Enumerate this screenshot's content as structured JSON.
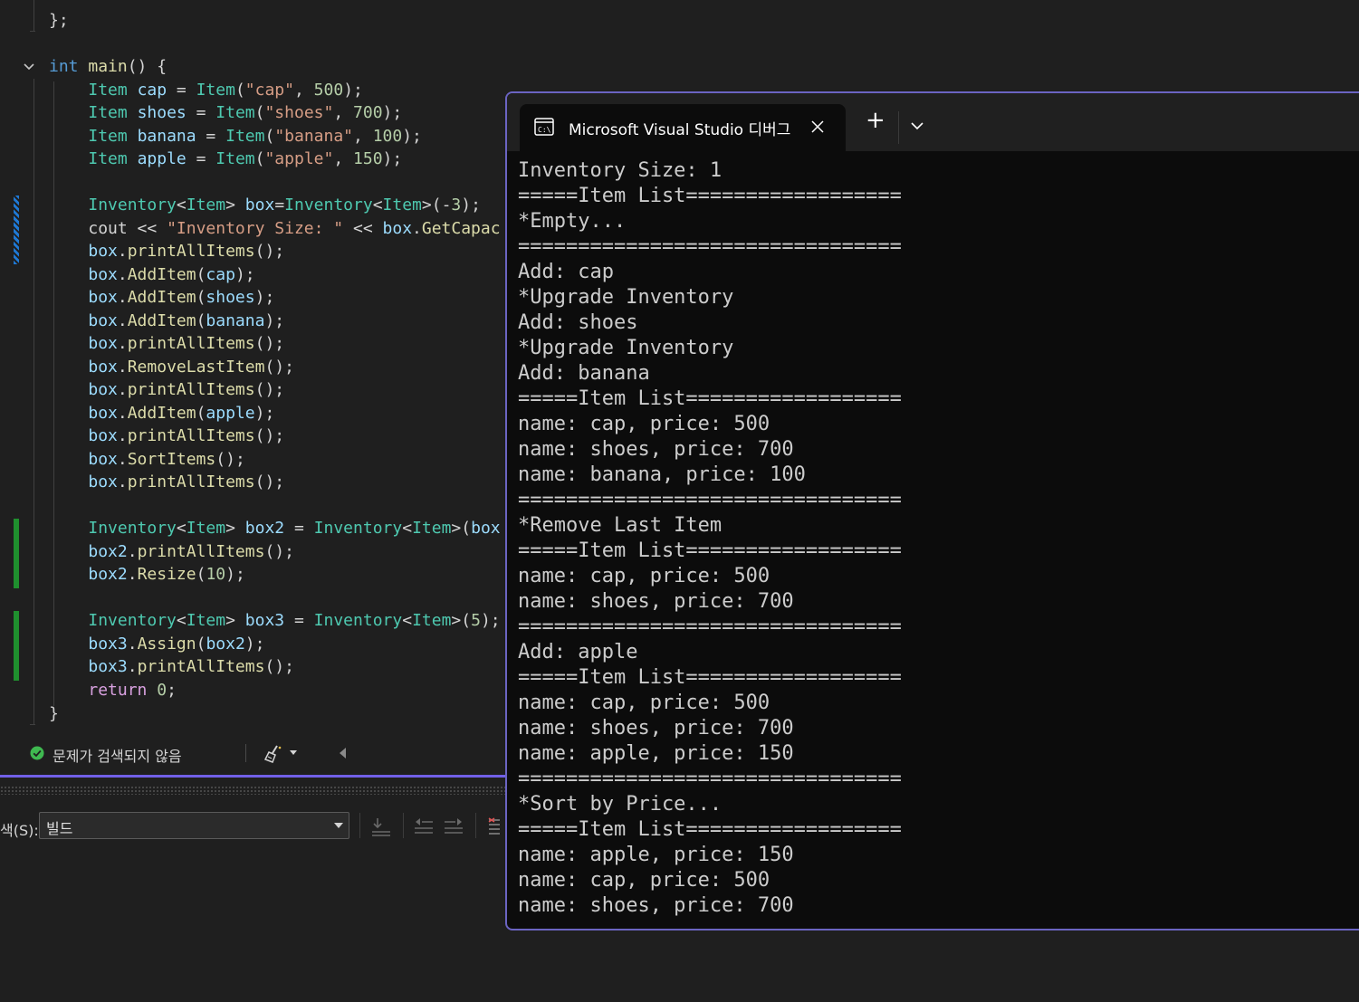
{
  "editor": {
    "lines": [
      [
        {
          "t": "};",
          "c": "plain"
        }
      ],
      [
        {
          "t": "int",
          "c": "kw"
        },
        {
          "t": " ",
          "c": "plain"
        },
        {
          "t": "main",
          "c": "func"
        },
        {
          "t": "() {",
          "c": "plain"
        }
      ],
      [
        {
          "t": "    ",
          "c": "plain"
        },
        {
          "t": "Item",
          "c": "type"
        },
        {
          "t": " ",
          "c": "plain"
        },
        {
          "t": "cap",
          "c": "var"
        },
        {
          "t": " = ",
          "c": "plain"
        },
        {
          "t": "Item",
          "c": "type"
        },
        {
          "t": "(",
          "c": "plain"
        },
        {
          "t": "\"cap\"",
          "c": "str"
        },
        {
          "t": ", ",
          "c": "plain"
        },
        {
          "t": "500",
          "c": "num"
        },
        {
          "t": ");",
          "c": "plain"
        }
      ],
      [
        {
          "t": "    ",
          "c": "plain"
        },
        {
          "t": "Item",
          "c": "type"
        },
        {
          "t": " ",
          "c": "plain"
        },
        {
          "t": "shoes",
          "c": "var"
        },
        {
          "t": " = ",
          "c": "plain"
        },
        {
          "t": "Item",
          "c": "type"
        },
        {
          "t": "(",
          "c": "plain"
        },
        {
          "t": "\"shoes\"",
          "c": "str"
        },
        {
          "t": ", ",
          "c": "plain"
        },
        {
          "t": "700",
          "c": "num"
        },
        {
          "t": ");",
          "c": "plain"
        }
      ],
      [
        {
          "t": "    ",
          "c": "plain"
        },
        {
          "t": "Item",
          "c": "type"
        },
        {
          "t": " ",
          "c": "plain"
        },
        {
          "t": "banana",
          "c": "var"
        },
        {
          "t": " = ",
          "c": "plain"
        },
        {
          "t": "Item",
          "c": "type"
        },
        {
          "t": "(",
          "c": "plain"
        },
        {
          "t": "\"banana\"",
          "c": "str"
        },
        {
          "t": ", ",
          "c": "plain"
        },
        {
          "t": "100",
          "c": "num"
        },
        {
          "t": ");",
          "c": "plain"
        }
      ],
      [
        {
          "t": "    ",
          "c": "plain"
        },
        {
          "t": "Item",
          "c": "type"
        },
        {
          "t": " ",
          "c": "plain"
        },
        {
          "t": "apple",
          "c": "var"
        },
        {
          "t": " = ",
          "c": "plain"
        },
        {
          "t": "Item",
          "c": "type"
        },
        {
          "t": "(",
          "c": "plain"
        },
        {
          "t": "\"apple\"",
          "c": "str"
        },
        {
          "t": ", ",
          "c": "plain"
        },
        {
          "t": "150",
          "c": "num"
        },
        {
          "t": ");",
          "c": "plain"
        }
      ],
      [],
      [
        {
          "t": "    ",
          "c": "plain"
        },
        {
          "t": "Inventory",
          "c": "type"
        },
        {
          "t": "<",
          "c": "plain"
        },
        {
          "t": "Item",
          "c": "type"
        },
        {
          "t": "> ",
          "c": "plain"
        },
        {
          "t": "box",
          "c": "var"
        },
        {
          "t": "=",
          "c": "plain"
        },
        {
          "t": "Inventory",
          "c": "type"
        },
        {
          "t": "<",
          "c": "plain"
        },
        {
          "t": "Item",
          "c": "type"
        },
        {
          "t": ">(-",
          "c": "plain"
        },
        {
          "t": "3",
          "c": "num"
        },
        {
          "t": ");",
          "c": "plain"
        }
      ],
      [
        {
          "t": "    ",
          "c": "plain"
        },
        {
          "t": "cout",
          "c": "plain"
        },
        {
          "t": " << ",
          "c": "plain"
        },
        {
          "t": "\"Inventory Size: \"",
          "c": "str"
        },
        {
          "t": " << ",
          "c": "plain"
        },
        {
          "t": "box",
          "c": "var"
        },
        {
          "t": ".",
          "c": "plain"
        },
        {
          "t": "GetCapac",
          "c": "func"
        }
      ],
      [
        {
          "t": "    ",
          "c": "plain"
        },
        {
          "t": "box",
          "c": "var"
        },
        {
          "t": ".",
          "c": "plain"
        },
        {
          "t": "printAllItems",
          "c": "func"
        },
        {
          "t": "();",
          "c": "plain"
        }
      ],
      [
        {
          "t": "    ",
          "c": "plain"
        },
        {
          "t": "box",
          "c": "var"
        },
        {
          "t": ".",
          "c": "plain"
        },
        {
          "t": "AddItem",
          "c": "func"
        },
        {
          "t": "(",
          "c": "plain"
        },
        {
          "t": "cap",
          "c": "var"
        },
        {
          "t": ");",
          "c": "plain"
        }
      ],
      [
        {
          "t": "    ",
          "c": "plain"
        },
        {
          "t": "box",
          "c": "var"
        },
        {
          "t": ".",
          "c": "plain"
        },
        {
          "t": "AddItem",
          "c": "func"
        },
        {
          "t": "(",
          "c": "plain"
        },
        {
          "t": "shoes",
          "c": "var"
        },
        {
          "t": ");",
          "c": "plain"
        }
      ],
      [
        {
          "t": "    ",
          "c": "plain"
        },
        {
          "t": "box",
          "c": "var"
        },
        {
          "t": ".",
          "c": "plain"
        },
        {
          "t": "AddItem",
          "c": "func"
        },
        {
          "t": "(",
          "c": "plain"
        },
        {
          "t": "banana",
          "c": "var"
        },
        {
          "t": ");",
          "c": "plain"
        }
      ],
      [
        {
          "t": "    ",
          "c": "plain"
        },
        {
          "t": "box",
          "c": "var"
        },
        {
          "t": ".",
          "c": "plain"
        },
        {
          "t": "printAllItems",
          "c": "func"
        },
        {
          "t": "();",
          "c": "plain"
        }
      ],
      [
        {
          "t": "    ",
          "c": "plain"
        },
        {
          "t": "box",
          "c": "var"
        },
        {
          "t": ".",
          "c": "plain"
        },
        {
          "t": "RemoveLastItem",
          "c": "func"
        },
        {
          "t": "();",
          "c": "plain"
        }
      ],
      [
        {
          "t": "    ",
          "c": "plain"
        },
        {
          "t": "box",
          "c": "var"
        },
        {
          "t": ".",
          "c": "plain"
        },
        {
          "t": "printAllItems",
          "c": "func"
        },
        {
          "t": "();",
          "c": "plain"
        }
      ],
      [
        {
          "t": "    ",
          "c": "plain"
        },
        {
          "t": "box",
          "c": "var"
        },
        {
          "t": ".",
          "c": "plain"
        },
        {
          "t": "AddItem",
          "c": "func"
        },
        {
          "t": "(",
          "c": "plain"
        },
        {
          "t": "apple",
          "c": "var"
        },
        {
          "t": ");",
          "c": "plain"
        }
      ],
      [
        {
          "t": "    ",
          "c": "plain"
        },
        {
          "t": "box",
          "c": "var"
        },
        {
          "t": ".",
          "c": "plain"
        },
        {
          "t": "printAllItems",
          "c": "func"
        },
        {
          "t": "();",
          "c": "plain"
        }
      ],
      [
        {
          "t": "    ",
          "c": "plain"
        },
        {
          "t": "box",
          "c": "var"
        },
        {
          "t": ".",
          "c": "plain"
        },
        {
          "t": "SortItems",
          "c": "func"
        },
        {
          "t": "();",
          "c": "plain"
        }
      ],
      [
        {
          "t": "    ",
          "c": "plain"
        },
        {
          "t": "box",
          "c": "var"
        },
        {
          "t": ".",
          "c": "plain"
        },
        {
          "t": "printAllItems",
          "c": "func"
        },
        {
          "t": "();",
          "c": "plain"
        }
      ],
      [],
      [
        {
          "t": "    ",
          "c": "plain"
        },
        {
          "t": "Inventory",
          "c": "type"
        },
        {
          "t": "<",
          "c": "plain"
        },
        {
          "t": "Item",
          "c": "type"
        },
        {
          "t": "> ",
          "c": "plain"
        },
        {
          "t": "box2",
          "c": "var"
        },
        {
          "t": " = ",
          "c": "plain"
        },
        {
          "t": "Inventory",
          "c": "type"
        },
        {
          "t": "<",
          "c": "plain"
        },
        {
          "t": "Item",
          "c": "type"
        },
        {
          "t": ">(",
          "c": "plain"
        },
        {
          "t": "box",
          "c": "var"
        }
      ],
      [
        {
          "t": "    ",
          "c": "plain"
        },
        {
          "t": "box2",
          "c": "var"
        },
        {
          "t": ".",
          "c": "plain"
        },
        {
          "t": "printAllItems",
          "c": "func"
        },
        {
          "t": "();",
          "c": "plain"
        }
      ],
      [
        {
          "t": "    ",
          "c": "plain"
        },
        {
          "t": "box2",
          "c": "var"
        },
        {
          "t": ".",
          "c": "plain"
        },
        {
          "t": "Resize",
          "c": "func"
        },
        {
          "t": "(",
          "c": "plain"
        },
        {
          "t": "10",
          "c": "num"
        },
        {
          "t": ");",
          "c": "plain"
        }
      ],
      [],
      [
        {
          "t": "    ",
          "c": "plain"
        },
        {
          "t": "Inventory",
          "c": "type"
        },
        {
          "t": "<",
          "c": "plain"
        },
        {
          "t": "Item",
          "c": "type"
        },
        {
          "t": "> ",
          "c": "plain"
        },
        {
          "t": "box3",
          "c": "var"
        },
        {
          "t": " = ",
          "c": "plain"
        },
        {
          "t": "Inventory",
          "c": "type"
        },
        {
          "t": "<",
          "c": "plain"
        },
        {
          "t": "Item",
          "c": "type"
        },
        {
          "t": ">(",
          "c": "plain"
        },
        {
          "t": "5",
          "c": "num"
        },
        {
          "t": ");",
          "c": "plain"
        }
      ],
      [
        {
          "t": "    ",
          "c": "plain"
        },
        {
          "t": "box3",
          "c": "var"
        },
        {
          "t": ".",
          "c": "plain"
        },
        {
          "t": "Assign",
          "c": "func"
        },
        {
          "t": "(",
          "c": "plain"
        },
        {
          "t": "box2",
          "c": "var"
        },
        {
          "t": ");",
          "c": "plain"
        }
      ],
      [
        {
          "t": "    ",
          "c": "plain"
        },
        {
          "t": "box3",
          "c": "var"
        },
        {
          "t": ".",
          "c": "plain"
        },
        {
          "t": "printAllItems",
          "c": "func"
        },
        {
          "t": "();",
          "c": "plain"
        }
      ],
      [
        {
          "t": "    ",
          "c": "plain"
        },
        {
          "t": "return",
          "c": "ctrl"
        },
        {
          "t": " ",
          "c": "plain"
        },
        {
          "t": "0",
          "c": "num"
        },
        {
          "t": ";",
          "c": "plain"
        }
      ],
      [
        {
          "t": "}",
          "c": "plain"
        }
      ]
    ]
  },
  "status_bar": {
    "issues_text": "문제가 검색되지 않음",
    "issues_icon": "check-circle-icon",
    "cleanup_icon": "broom-icon"
  },
  "output_panel": {
    "show_output_label": "색(S):",
    "source_value": "빌드"
  },
  "terminal": {
    "tab_title": "Microsoft Visual Studio 디버그",
    "new_tab_label": "+",
    "output_lines": [
      "Inventory Size: 1",
      "=====Item List==================",
      "*Empty...",
      "================================",
      "Add: cap",
      "*Upgrade Inventory",
      "Add: shoes",
      "*Upgrade Inventory",
      "Add: banana",
      "=====Item List==================",
      "name: cap, price: 500",
      "name: shoes, price: 700",
      "name: banana, price: 100",
      "================================",
      "*Remove Last Item",
      "=====Item List==================",
      "name: cap, price: 500",
      "name: shoes, price: 700",
      "================================",
      "Add: apple",
      "=====Item List==================",
      "name: cap, price: 500",
      "name: shoes, price: 700",
      "name: apple, price: 150",
      "================================",
      "*Sort by Price...",
      "=====Item List==================",
      "name: apple, price: 150",
      "name: cap, price: 500",
      "name: shoes, price: 700"
    ]
  },
  "colors": {
    "accent_purple": "#7160e8",
    "terminal_border": "#6b64c2",
    "change_added": "#1f8f2e",
    "change_modified": "#1e78d4",
    "success_green": "#3fb950"
  }
}
